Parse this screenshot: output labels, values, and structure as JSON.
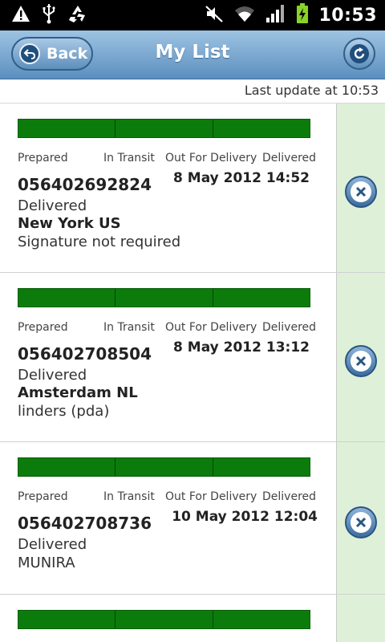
{
  "statusbar": {
    "time": "10:53",
    "icons": [
      "warning-icon",
      "usb-icon",
      "recycle-icon",
      "mute-icon",
      "wifi-icon",
      "signal-icon",
      "battery-charging-icon"
    ]
  },
  "navbar": {
    "back_label": "Back",
    "title": "My List"
  },
  "last_update": "Last update at 10:53",
  "shipments": [
    {
      "stages": [
        "Prepared",
        "In Transit",
        "Out For Delivery",
        "Delivered"
      ],
      "progress": 1.0,
      "tracking_number": "056402692824",
      "datetime": "8 May 2012 14:52",
      "status": "Delivered",
      "location": "New York US",
      "note": "Signature not required"
    },
    {
      "stages": [
        "Prepared",
        "In Transit",
        "Out For Delivery",
        "Delivered"
      ],
      "progress": 1.0,
      "tracking_number": "056402708504",
      "datetime": "8 May 2012 13:12",
      "status": "Delivered",
      "location": "Amsterdam NL",
      "note": "linders (pda)"
    },
    {
      "stages": [
        "Prepared",
        "In Transit",
        "Out For Delivery",
        "Delivered"
      ],
      "progress": 1.0,
      "tracking_number": "056402708736",
      "datetime": "10 May 2012 12:04",
      "status": "Delivered",
      "note": "MUNIRA"
    },
    {
      "progress": 1.0
    }
  ],
  "colors": {
    "progress_fill": "#0b7c0b",
    "side_panel": "#dff0d8",
    "nav_blue": "#5b8fbf"
  }
}
